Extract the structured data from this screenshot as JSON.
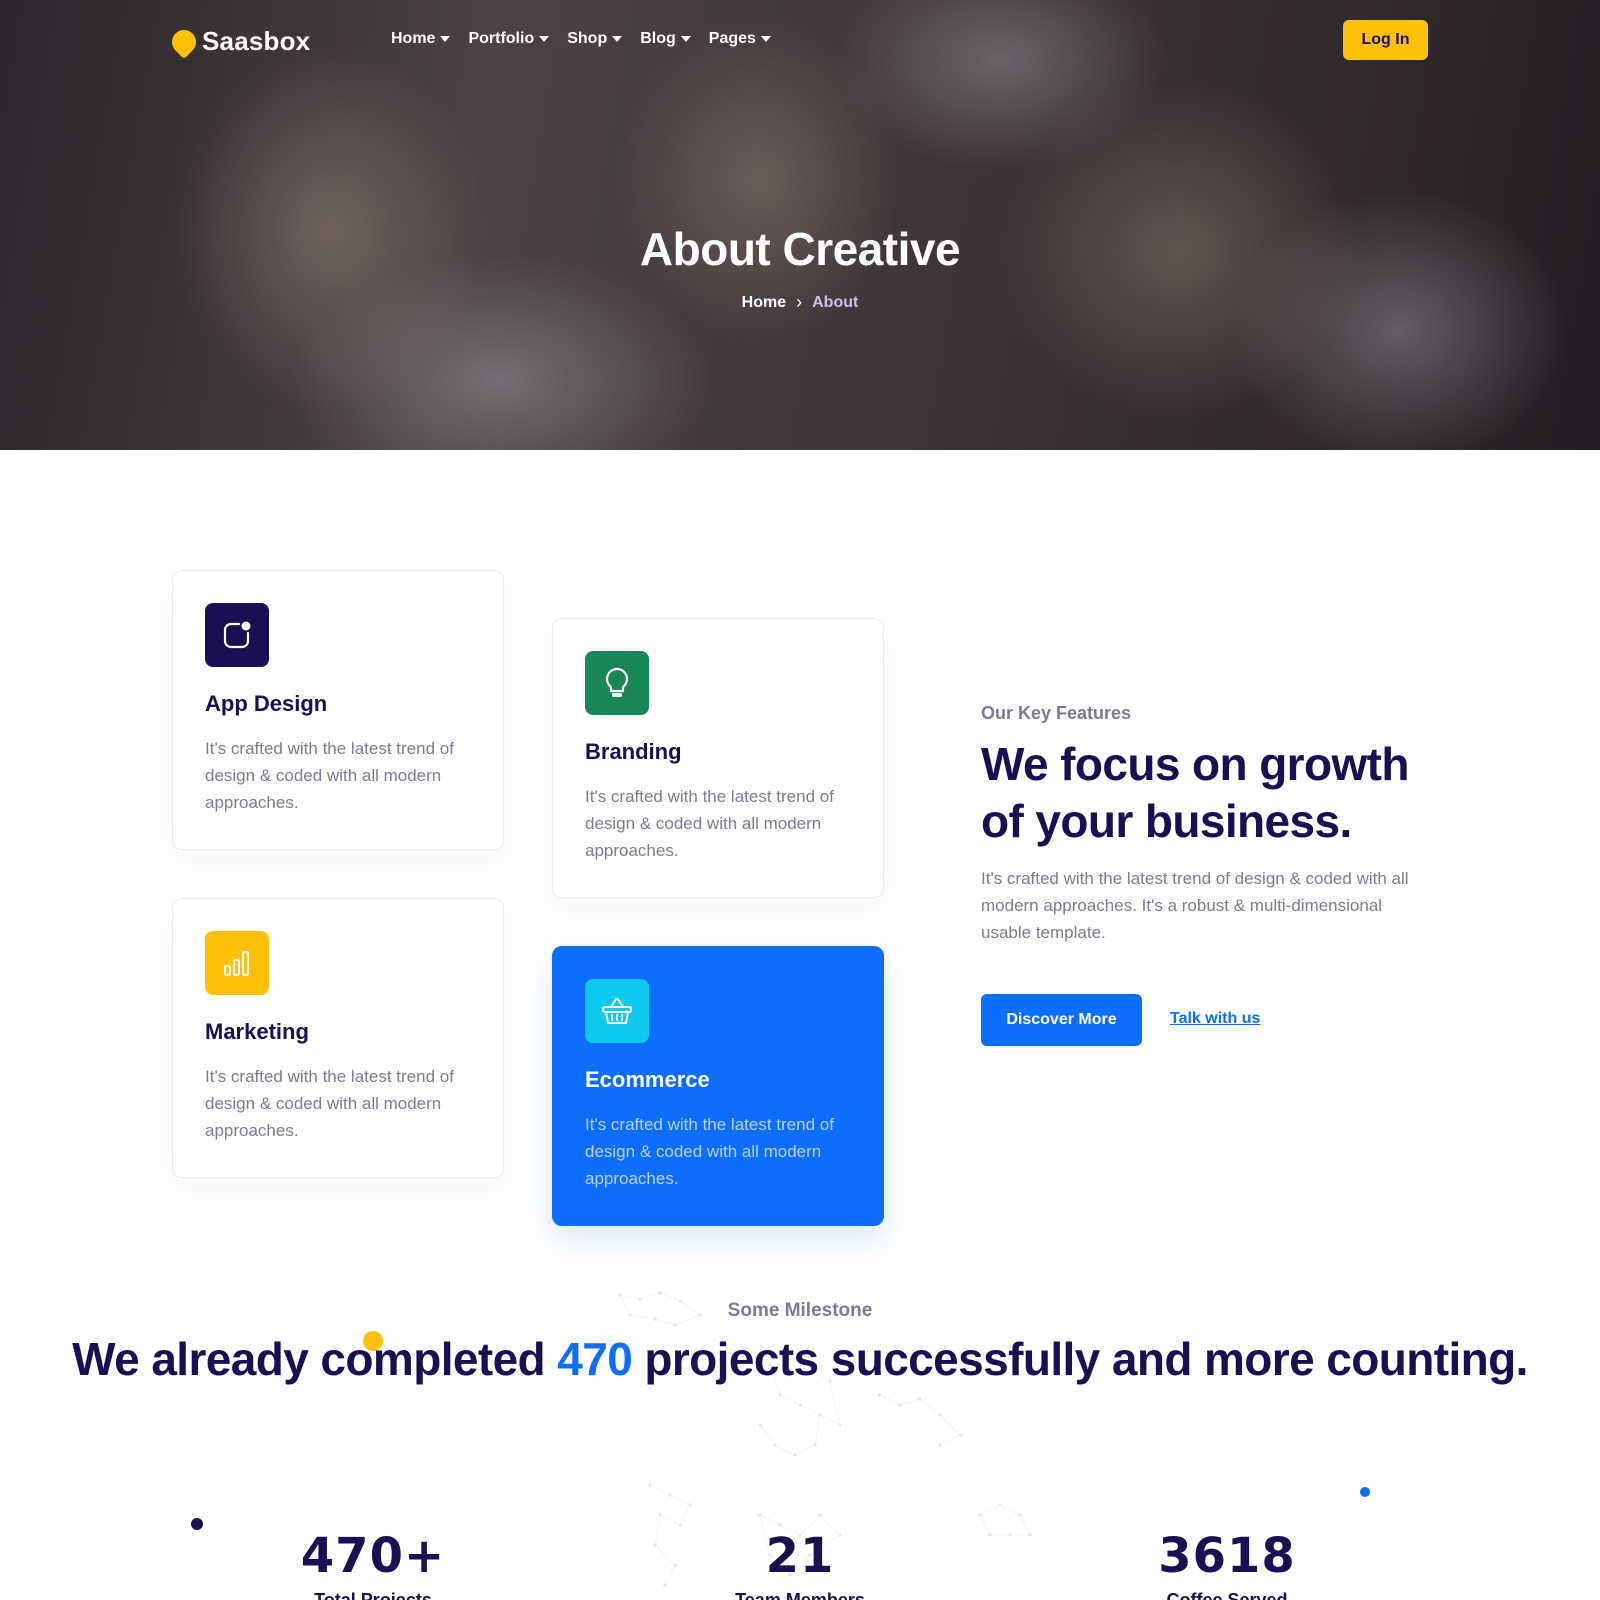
{
  "header": {
    "logo": "Saasbox",
    "nav": [
      "Home",
      "Portfolio",
      "Shop",
      "Blog",
      "Pages"
    ],
    "login": "Log In"
  },
  "hero": {
    "title": "About Creative",
    "breadcrumb": {
      "home": "Home",
      "current": "About"
    }
  },
  "features": {
    "cards": [
      {
        "title": "App Design",
        "desc": "It's crafted with the latest trend of design & coded with all modern approaches.",
        "icon": "app-icon",
        "color": "#1c0e52"
      },
      {
        "title": "Branding",
        "desc": "It's crafted with the latest trend of design & coded with all modern approaches.",
        "icon": "lightbulb-icon",
        "color": "#198754"
      },
      {
        "title": "Marketing",
        "desc": "It's crafted with the latest trend of design & coded with all modern approaches.",
        "icon": "bar-chart-icon",
        "color": "#ffc107"
      },
      {
        "title": "Ecommerce",
        "desc": "It's crafted with the latest trend of design & coded with all modern approaches.",
        "icon": "basket-icon",
        "color": "#0dcaf0"
      }
    ],
    "subtitle": "Our Key Features",
    "title": "We focus on growth of your business.",
    "desc": "It's crafted with the latest trend of design & coded with all modern approaches. It's a robust & multi-dimensional usable template.",
    "primary_button": "Discover More",
    "secondary_link": "Talk with us"
  },
  "milestone": {
    "subtitle": "Some Milestone",
    "title_before": "We already completed ",
    "title_highlight": "470",
    "title_after": " projects successfully and more counting.",
    "stats": [
      {
        "value": "470+",
        "label": "Total Projects"
      },
      {
        "value": "21",
        "label": "Team Members"
      },
      {
        "value": "3618",
        "label": "Coffee Served"
      }
    ]
  },
  "colors": {
    "primary": "#0d6efd",
    "accent": "#ffc107",
    "heading": "#1c0e52",
    "muted": "#7d7a96"
  }
}
